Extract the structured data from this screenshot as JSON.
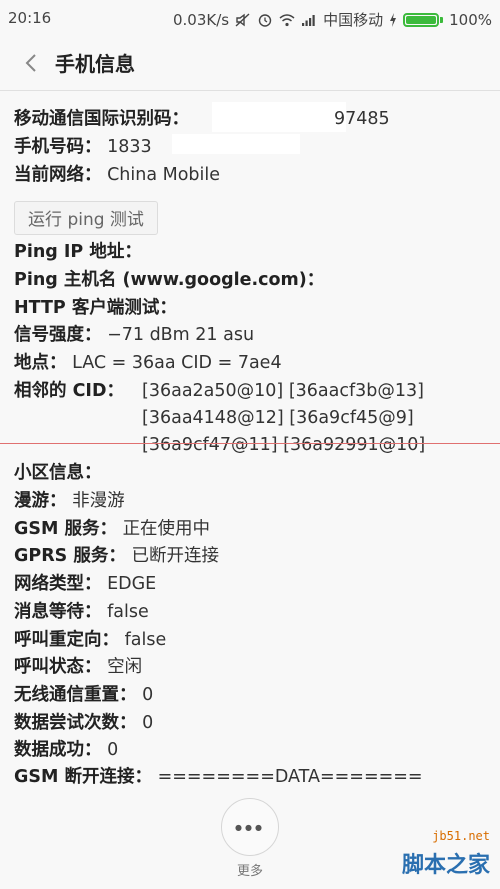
{
  "status_bar": {
    "time": "20:16",
    "speed": "0.03K/s",
    "carrier": "中国移动",
    "battery_percent": "100%",
    "battery_level": 1.0
  },
  "header": {
    "title": "手机信息"
  },
  "info": {
    "imei_label": "移动通信国际识别码：",
    "imei_value": "97485",
    "phone_label": "手机号码：",
    "phone_value": "1833",
    "network_label": "当前网络：",
    "network_value": "China Mobile",
    "ping_button": "运行 ping 测试",
    "ping_ip_label": "Ping IP 地址：",
    "ping_host_label": "Ping 主机名 (www.google.com)：",
    "http_label": "HTTP 客户端测试：",
    "signal_label": "信号强度：",
    "signal_value": "−71 dBm   21 asu",
    "location_label": "地点：",
    "location_value": "LAC = 36aa   CID = 7ae4",
    "neighbor_label": "相邻的 CID：",
    "neighbor_lines": [
      "[36aa2a50@10] [36aacf3b@13]",
      "[36aa4148@12] [36a9cf45@9]",
      "[36a9cf47@11] [36a92991@10]"
    ],
    "cell_label": "小区信息：",
    "roaming_label": "漫游：",
    "roaming_value": "非漫游",
    "gsm_label": "GSM 服务：",
    "gsm_value": "正在使用中",
    "gprs_label": "GPRS 服务：",
    "gprs_value": "已断开连接",
    "nettype_label": "网络类型：",
    "nettype_value": "EDGE",
    "msg_wait_label": "消息等待：",
    "msg_wait_value": "false",
    "call_redirect_label": "呼叫重定向：",
    "call_redirect_value": "false",
    "call_state_label": "呼叫状态：",
    "call_state_value": "空闲",
    "radio_reset_label": "无线通信重置：",
    "radio_reset_value": "0",
    "data_attempt_label": "数据尝试次数：",
    "data_attempt_value": "0",
    "data_success_label": "数据成功：",
    "data_success_value": "0",
    "gsm_disconnect_label": "GSM 断开连接：",
    "gsm_disconnect_value": "========DATA======="
  },
  "footer": {
    "more_label": "更多"
  },
  "watermark": {
    "url": "jb51.net",
    "name": "脚本之家"
  },
  "colors": {
    "battery": "#3cba3c",
    "divider": "#e07070"
  }
}
